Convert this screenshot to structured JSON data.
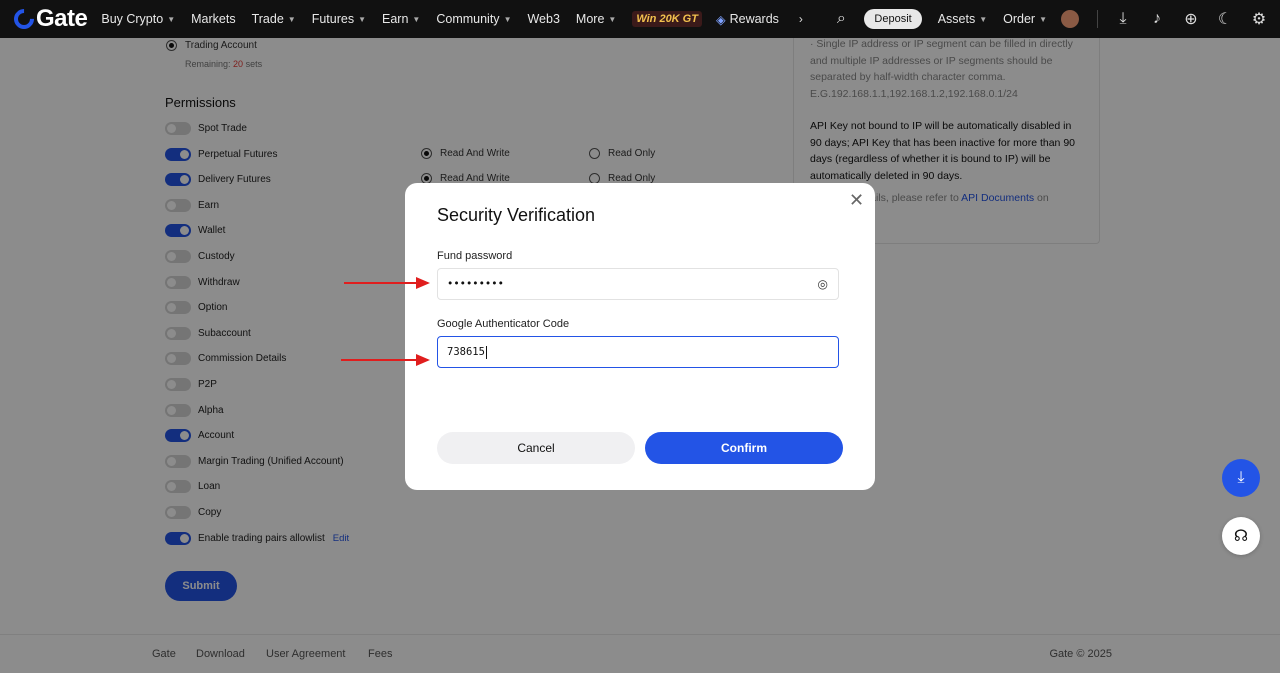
{
  "nav": {
    "logo": "Gate",
    "items": [
      "Buy Crypto",
      "Markets",
      "Trade",
      "Futures",
      "Earn",
      "Community",
      "Web3",
      "More"
    ],
    "promo": "Win 20K GT",
    "rewards": "Rewards",
    "deposit": "Deposit",
    "assets": "Assets",
    "order": "Order"
  },
  "account": {
    "trading_account": "Trading Account",
    "remaining_prefix": "Remaining:",
    "remaining_count": "20",
    "remaining_suffix": "sets"
  },
  "permissions": {
    "title": "Permissions",
    "items": [
      {
        "label": "Spot Trade",
        "on": false
      },
      {
        "label": "Perpetual Futures",
        "on": true
      },
      {
        "label": "Delivery Futures",
        "on": true
      },
      {
        "label": "Earn",
        "on": false
      },
      {
        "label": "Wallet",
        "on": true
      },
      {
        "label": "Custody",
        "on": false
      },
      {
        "label": "Withdraw",
        "on": false
      },
      {
        "label": "Option",
        "on": false
      },
      {
        "label": "Subaccount",
        "on": false
      },
      {
        "label": "Commission Details",
        "on": false
      },
      {
        "label": "P2P",
        "on": false
      },
      {
        "label": "Alpha",
        "on": false
      },
      {
        "label": "Account",
        "on": true
      },
      {
        "label": "Margin Trading (Unified Account)",
        "on": false
      },
      {
        "label": "Loan",
        "on": false
      },
      {
        "label": "Copy",
        "on": false
      },
      {
        "label": "Enable trading pairs allowlist",
        "on": true
      }
    ],
    "edit": "Edit",
    "read_write": "Read And Write",
    "read_only": "Read Only",
    "submit": "Submit"
  },
  "info": {
    "ip_tip": "· Single IP address or IP segment can be filled in directly and multiple IP addresses or IP segments should be separated by half-width character comma. E.G.192.168.1.1,192.168.1.2,192.168.0.1/24",
    "warning": "API Key not bound to IP will be automatically disabled in 90 days; API Key that has been inactive for more than 90 days (regardless of whether it is bound to IP) will be automatically deleted in 90 days.",
    "more_prefix": "For more details, please refer to",
    "more_link": "API Documents",
    "more_suffix": "on"
  },
  "footer": {
    "links": [
      "Gate",
      "Download",
      "User Agreement",
      "Fees"
    ],
    "copyright": "Gate © 2025"
  },
  "modal": {
    "title": "Security Verification",
    "fund_label": "Fund password",
    "fund_value": "•••••••••",
    "ga_label": "Google Authenticator Code",
    "ga_value": "738615",
    "cancel": "Cancel",
    "confirm": "Confirm"
  },
  "colors": {
    "accent": "#2354e6",
    "arrow": "#e01e1e"
  }
}
